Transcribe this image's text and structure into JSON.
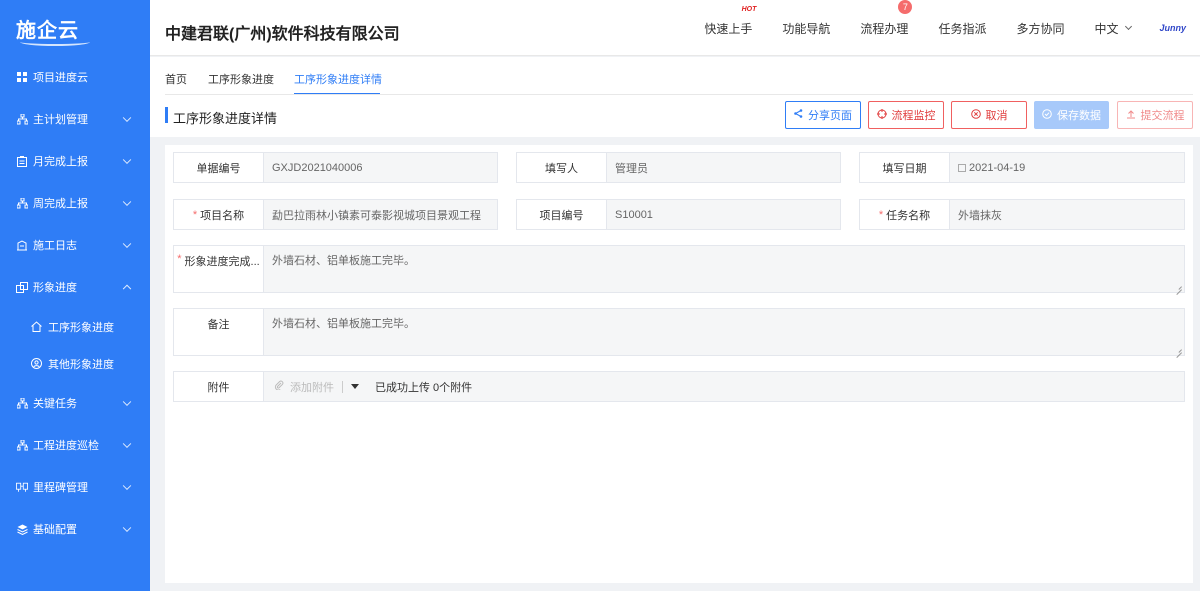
{
  "app": {
    "logo_text": "施企云",
    "company": "中建君联(广州)软件科技有限公司"
  },
  "topnav": {
    "quickstart": "快速上手",
    "hot_label": "HOT",
    "function_nav": "功能导航",
    "process": "流程办理",
    "process_badge": "7",
    "task_assign": "任务指派",
    "collab": "多方协同",
    "language": "中文",
    "brand": "Junny"
  },
  "sidebar": {
    "items": [
      {
        "label": "项目进度云",
        "icon": "grid-icon"
      },
      {
        "label": "主计划管理",
        "icon": "org-icon"
      },
      {
        "label": "月完成上报",
        "icon": "clipboard-icon"
      },
      {
        "label": "周完成上报",
        "icon": "org-icon"
      },
      {
        "label": "施工日志",
        "icon": "journal-icon"
      },
      {
        "label": "形象进度",
        "icon": "stack-icon"
      },
      {
        "label": "工序形象进度",
        "icon": "home-icon"
      },
      {
        "label": "其他形象进度",
        "icon": "user-circle-icon"
      },
      {
        "label": "关键任务",
        "icon": "org-icon"
      },
      {
        "label": "工程进度巡检",
        "icon": "org-icon"
      },
      {
        "label": "里程碑管理",
        "icon": "milestone-icon"
      },
      {
        "label": "基础配置",
        "icon": "layers-icon"
      }
    ]
  },
  "breadcrumbs": [
    "首页",
    "工序形象进度",
    "工序形象进度详情"
  ],
  "page": {
    "title": "工序形象进度详情",
    "buttons": {
      "share": "分享页面",
      "monitor": "流程监控",
      "cancel": "取消",
      "save": "保存数据",
      "submit": "提交流程"
    }
  },
  "form": {
    "doc_no_label": "单据编号",
    "doc_no": "GXJD2021040006",
    "filler_label": "填写人",
    "filler": "管理员",
    "date_label": "填写日期",
    "date": "2021-04-19",
    "project_name_label": "项目名称",
    "project_name": "勐巴拉雨林小镇素可泰影视城项目景观工程",
    "project_no_label": "项目编号",
    "project_no": "S10001",
    "task_name_label": "任务名称",
    "task_name": "外墙抹灰",
    "progress_label": "形象进度完成...",
    "progress": "外墙石材、铝单板施工完毕。",
    "remark_label": "备注",
    "remark": "外墙石材、铝单板施工完毕。",
    "attach_label": "附件",
    "attach_add": "添加附件",
    "attach_status": "已成功上传 0个附件"
  },
  "colors": {
    "primary": "#2f7df6",
    "danger": "#e03c3c",
    "disabled_primary": "#a7c9fa"
  }
}
